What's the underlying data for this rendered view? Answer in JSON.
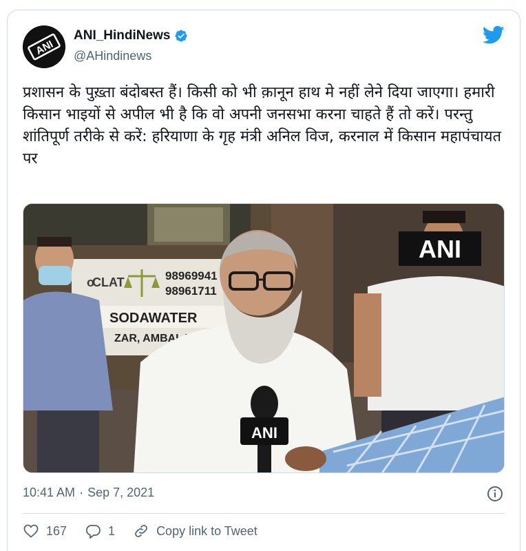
{
  "author": {
    "display_name": "ANI_HindiNews",
    "handle": "@AHindinews",
    "avatar_label": "ANI",
    "verified": true
  },
  "tweet": {
    "text": "प्रशासन के पुख़्ता बंदोबस्त हैं। किसी को भी क़ानून हाथ मे नहीं लेने दिया जाएगा। हमारी किसान भाइयों से अपील भी है कि वो अपनी जनसभा करना चाहते हैं तो करें। परन्तु शांतिपूर्ण तरीके से करें: हरियाणा के गृह मंत्री अनिल विज, करनाल में किसान महापंचायत पर"
  },
  "media": {
    "watermark": "ANI",
    "mic_label": "ANI",
    "sign_line1": "98969941",
    "sign_line2": "98961711",
    "sign_clat": "CLAT",
    "sign_sodawater": "SODAWATER",
    "sign_address": "ZAR, AMBALA",
    "sign_prefix": "o"
  },
  "meta": {
    "time": "10:41 AM",
    "separator": "·",
    "date": "Sep 7, 2021"
  },
  "actions": {
    "likes": "167",
    "replies": "1",
    "copy_link_label": "Copy link to Tweet"
  },
  "colors": {
    "verified": "#1d9bf0",
    "twitter_blue": "#1d9bf0",
    "secondary_text": "#536471"
  }
}
